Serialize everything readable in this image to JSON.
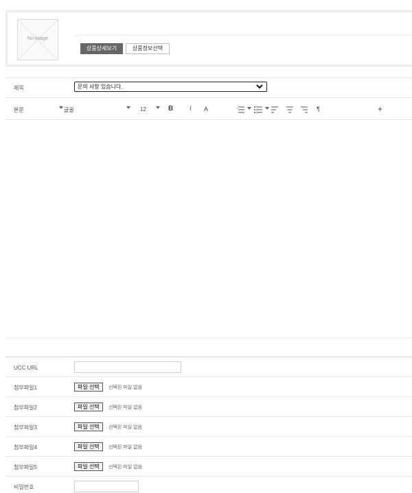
{
  "product": {
    "noimage_text": "No image",
    "detail_button": "상품상세보기",
    "select_button": "상품정보선택"
  },
  "subject": {
    "label": "제목",
    "selected": "문의 사항 있습니다."
  },
  "toolbar": {
    "paragraph": "본문",
    "font": "글꼴",
    "font_size": "12",
    "bold": "B",
    "italic": "i",
    "text_style": "Ạ",
    "paragraph_mark": "¶",
    "insert": "+"
  },
  "fields": {
    "ucc_label": "UCC URL",
    "attachments": [
      {
        "label": "첨부파일1",
        "button": "파일 선택",
        "status": "선택된 파일 없음"
      },
      {
        "label": "첨부파일2",
        "button": "파일 선택",
        "status": "선택된 파일 없음"
      },
      {
        "label": "첨부파일3",
        "button": "파일 선택",
        "status": "선택된 파일 없음"
      },
      {
        "label": "첨부파일4",
        "button": "파일 선택",
        "status": "선택된 파일 없음"
      },
      {
        "label": "첨부파일5",
        "button": "파일 선택",
        "status": "선택된 파일 없음"
      }
    ],
    "password_label": "비밀번호"
  },
  "icons": [
    "no-image-placeholder-icon",
    "chevron-down-icon",
    "caret-down-icon",
    "bold-icon",
    "italic-icon",
    "text-style-icon",
    "ordered-list-icon",
    "unordered-list-icon",
    "align-left-icon",
    "align-center-icon",
    "align-right-icon",
    "paragraph-icon",
    "insert-icon"
  ]
}
